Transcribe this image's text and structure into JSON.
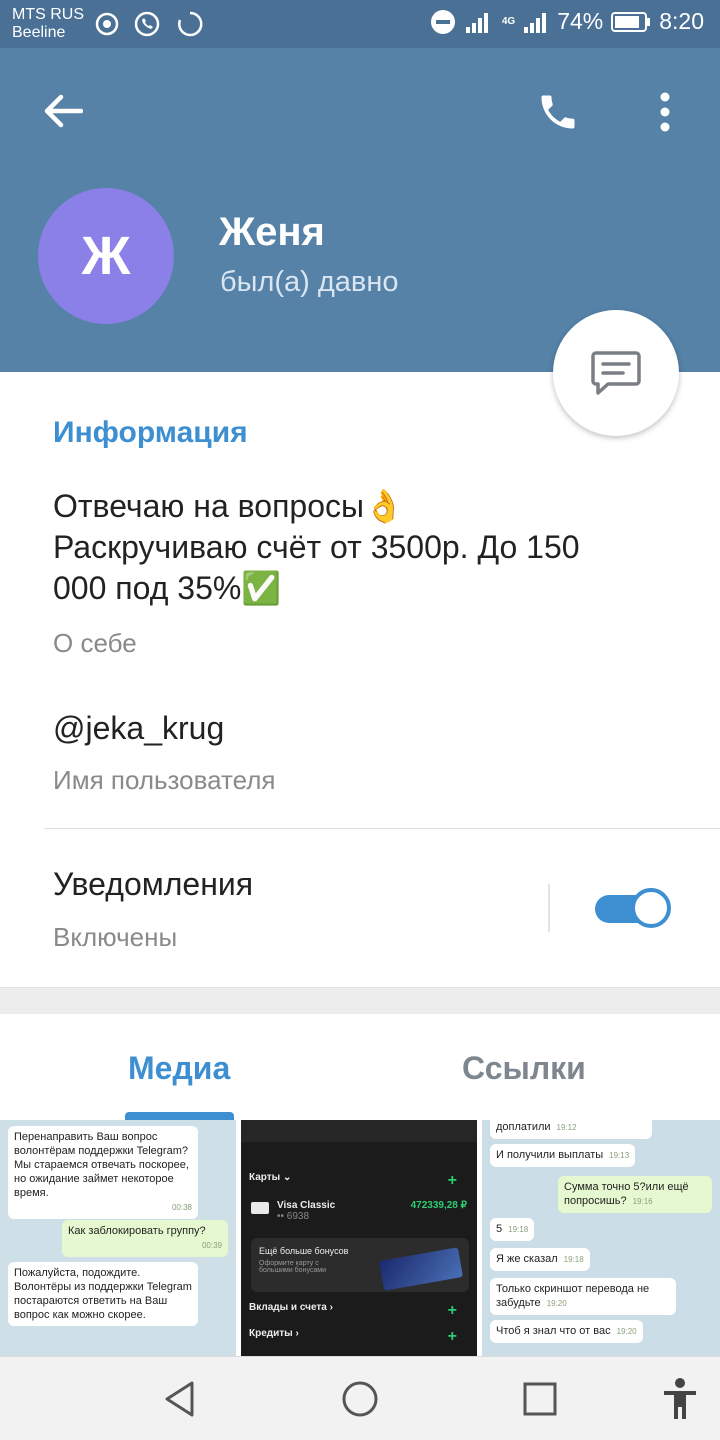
{
  "status_bar": {
    "carrier_line1": "MTS RUS",
    "carrier_line2": "Beeline",
    "battery": "74%",
    "time": "8:20",
    "network": "4G"
  },
  "header": {
    "avatar_letter": "Ж",
    "avatar_color": "#8a80e8",
    "name": "Женя",
    "last_seen": "был(а) давно"
  },
  "info": {
    "section_title": "Информация",
    "bio_line1": "Отвечаю на вопросы👌",
    "bio_line2": "Раскручиваю счёт от 3500р. До 150",
    "bio_line3": "000 под 35%✅",
    "bio_caption": "О себе",
    "username": "@jeka_krug",
    "username_caption": "Имя пользователя",
    "notifications_title": "Уведомления",
    "notifications_status": "Включены",
    "notifications_on": true
  },
  "tabs": {
    "media": "Медиа",
    "links": "Ссылки"
  },
  "media": {
    "thumb1": {
      "b1": "Перенаправить Ваш вопрос волонтёрам поддержки Telegram?",
      "b1b": "Мы стараемся отвечать поскорее, но ожидание займет некоторое время.",
      "b1_time": "00:38",
      "b2": "Как заблокировать группу?",
      "b2_time": "00:39",
      "b3": "Пожалуйста, подождите. Волонтёры из поддержки Telegram постараются ответить на Ваш вопрос как можно скорее."
    },
    "thumb2": {
      "cards": "Карты",
      "card_name": "Visa Classic",
      "card_num": "•• 6938",
      "card_balance": "472339,28 ₽",
      "bonus": "Ещё больше бонусов",
      "bonus_sub": "Оформите карту с большими бонусами",
      "deposits": "Вклады и счета",
      "credits": "Кредиты"
    },
    "thumb3": {
      "m1": "доплатили",
      "m1_time": "19:12",
      "m2": "И получили выплаты",
      "m2_time": "19:13",
      "m3": "Сумма точно 5?или ещё попросишь?",
      "m3_time": "19:16",
      "m4": "5",
      "m4_time": "19:18",
      "m5": "Я же сказал",
      "m5_time": "19:18",
      "m6": "Только скриншот перевода не забудьте",
      "m6_time": "19:20",
      "m7": "Чтоб я знал что от вас",
      "m7_time": "19:20"
    }
  },
  "colors": {
    "header_bg": "#5682a8",
    "status_bg": "#4a7096",
    "accent": "#3d8fd1"
  },
  "icons": {
    "back": "arrow-left-icon",
    "call": "phone-icon",
    "more": "more-vertical-icon",
    "message": "message-icon"
  }
}
